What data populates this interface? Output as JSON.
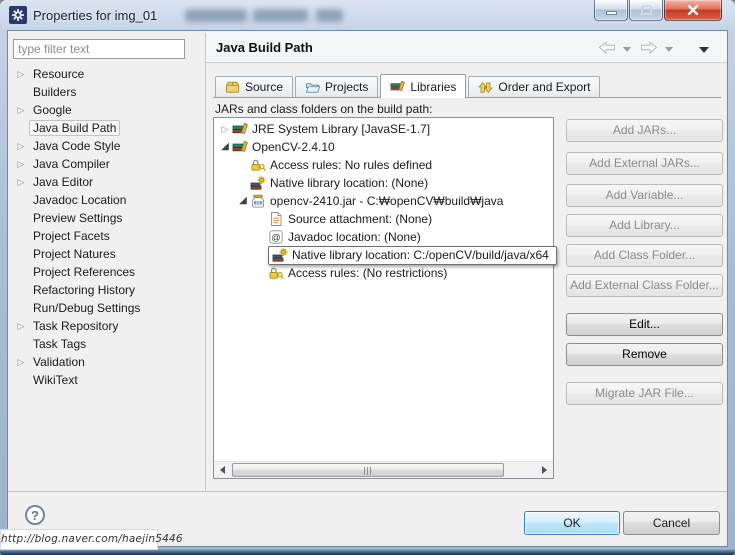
{
  "window": {
    "title": "Properties for img_01",
    "controls": {
      "minimize": "minimize-icon",
      "maximize": "maximize-icon",
      "close": "close-icon"
    }
  },
  "sidebar": {
    "filter_placeholder": "type filter text",
    "items": [
      {
        "label": "Resource",
        "expandable": true,
        "selected": false
      },
      {
        "label": "Builders",
        "expandable": false,
        "selected": false
      },
      {
        "label": "Google",
        "expandable": true,
        "selected": false
      },
      {
        "label": "Java Build Path",
        "expandable": false,
        "selected": true
      },
      {
        "label": "Java Code Style",
        "expandable": true,
        "selected": false
      },
      {
        "label": "Java Compiler",
        "expandable": true,
        "selected": false
      },
      {
        "label": "Java Editor",
        "expandable": true,
        "selected": false
      },
      {
        "label": "Javadoc Location",
        "expandable": false,
        "selected": false
      },
      {
        "label": "Preview Settings",
        "expandable": false,
        "selected": false
      },
      {
        "label": "Project Facets",
        "expandable": false,
        "selected": false
      },
      {
        "label": "Project Natures",
        "expandable": false,
        "selected": false
      },
      {
        "label": "Project References",
        "expandable": false,
        "selected": false
      },
      {
        "label": "Refactoring History",
        "expandable": false,
        "selected": false
      },
      {
        "label": "Run/Debug Settings",
        "expandable": false,
        "selected": false
      },
      {
        "label": "Task Repository",
        "expandable": true,
        "selected": false
      },
      {
        "label": "Task Tags",
        "expandable": false,
        "selected": false
      },
      {
        "label": "Validation",
        "expandable": true,
        "selected": false
      },
      {
        "label": "WikiText",
        "expandable": false,
        "selected": false
      }
    ]
  },
  "header": {
    "title": "Java Build Path"
  },
  "tabs": [
    {
      "label": "Source",
      "icon": "package-folder-icon",
      "active": false
    },
    {
      "label": "Projects",
      "icon": "open-folder-icon",
      "active": false
    },
    {
      "label": "Libraries",
      "icon": "library-books-icon",
      "active": true
    },
    {
      "label": "Order and Export",
      "icon": "order-arrows-icon",
      "active": false
    }
  ],
  "content": {
    "caption": "JARs and class folders on the build path:",
    "tree": [
      {
        "label": "JRE System Library [JavaSE-1.7]",
        "icon": "library-books-icon",
        "level": 0,
        "expand": "collapsed",
        "selected": false
      },
      {
        "label": "OpenCV-2.4.10",
        "icon": "library-books-icon",
        "level": 0,
        "expand": "expanded",
        "selected": false
      },
      {
        "label": "Access rules: No rules defined",
        "icon": "access-rules-lock-icon",
        "level": 1,
        "expand": "none",
        "selected": false
      },
      {
        "label": "Native library location: (None)",
        "icon": "native-library-icon",
        "level": 1,
        "expand": "none",
        "selected": false
      },
      {
        "label": "opencv-2410.jar - C:₩openCV₩build₩java",
        "icon": "jar-file-icon",
        "level": 1,
        "expand": "expanded",
        "selected": false
      },
      {
        "label": "Source attachment: (None)",
        "icon": "source-attachment-icon",
        "level": 2,
        "expand": "none",
        "selected": false
      },
      {
        "label": "Javadoc location: (None)",
        "icon": "javadoc-icon",
        "level": 2,
        "expand": "none",
        "selected": false
      },
      {
        "label": "Native library location: C:/openCV/build/java/x64",
        "icon": "native-library-icon",
        "level": 2,
        "expand": "none",
        "selected": true
      },
      {
        "label": "Access rules: (No restrictions)",
        "icon": "access-rules-lock-icon",
        "level": 2,
        "expand": "none",
        "selected": false
      }
    ]
  },
  "actions": [
    {
      "label": "Add JARs...",
      "enabled": false
    },
    {
      "label": "Add External JARs...",
      "enabled": false
    },
    {
      "label": "Add Variable...",
      "enabled": false
    },
    {
      "label": "Add Library...",
      "enabled": false
    },
    {
      "label": "Add Class Folder...",
      "enabled": false
    },
    {
      "label": "Add External Class Folder...",
      "enabled": false
    },
    {
      "label": "Edit...",
      "enabled": true
    },
    {
      "label": "Remove",
      "enabled": true
    },
    {
      "label": "Migrate JAR File...",
      "enabled": false
    }
  ],
  "footer": {
    "ok_label": "OK",
    "cancel_label": "Cancel",
    "help_glyph": "?"
  },
  "watermark": {
    "text": "http://blog.naver.com/haejin5446"
  },
  "colors": {
    "close_button_red": "#c23a22",
    "default_button_blue": "#3c7fb1",
    "frame_blue": "#9db3cc"
  }
}
